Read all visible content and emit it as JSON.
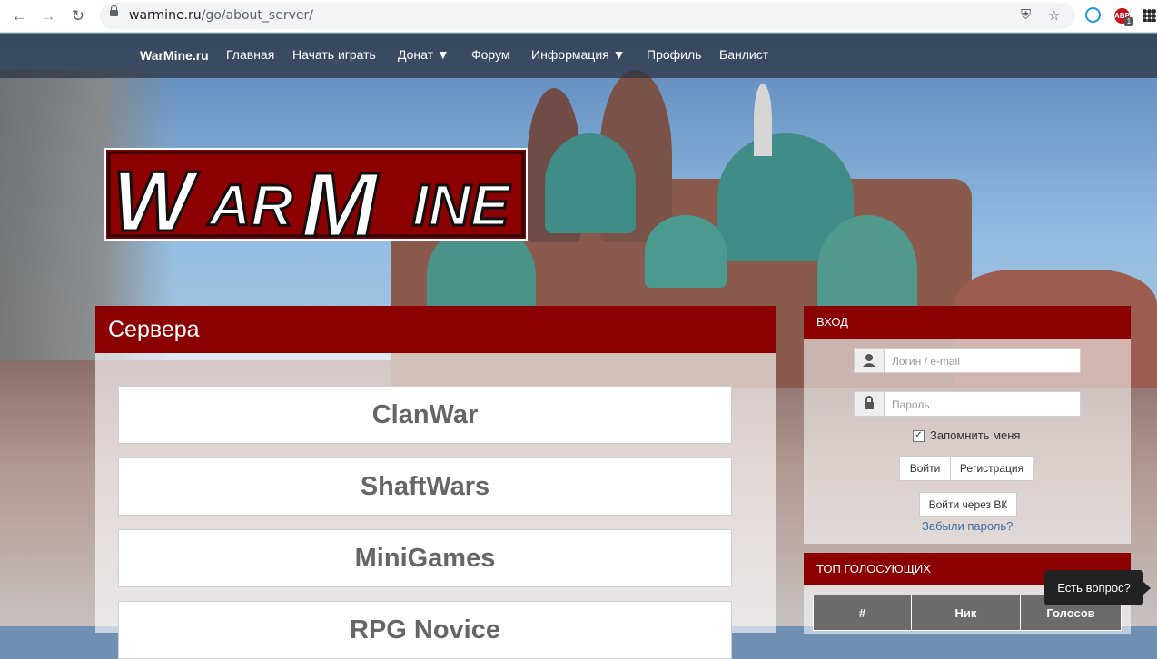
{
  "browser": {
    "url_host": "warmine.ru",
    "url_path": "/go/about_server/",
    "icons": [
      "back-icon",
      "forward-icon",
      "reload-icon",
      "lock-icon",
      "shield-icon",
      "star-icon",
      "extension-icon",
      "adblock-icon",
      "grid-icon"
    ],
    "adblock_badge": "ABP",
    "adblock_count": "1"
  },
  "nav": {
    "brand": "WarMine.ru",
    "items": [
      {
        "label": "Главная"
      },
      {
        "label": "Начать играть"
      },
      {
        "label": "Донат ▼"
      },
      {
        "label": "Форум"
      },
      {
        "label": "Информация ▼"
      },
      {
        "label": "Профиль"
      },
      {
        "label": "Банлист"
      }
    ]
  },
  "logo": {
    "text": "WarMine"
  },
  "servers": {
    "title": "Сервера",
    "list": [
      {
        "name": "ClanWar"
      },
      {
        "name": "ShaftWars"
      },
      {
        "name": "MiniGames"
      },
      {
        "name": "RPG Novice"
      }
    ]
  },
  "login": {
    "title": "ВХОД",
    "login_placeholder": "Логин / e-mail",
    "password_placeholder": "Пароль",
    "remember_label": "Запомнить меня",
    "remember_checked": true,
    "login_button": "Войти",
    "register_button": "Регистрация",
    "vk_button": "Войти через ВК",
    "forgot_link": "Забыли пароль?"
  },
  "voters": {
    "title": "ТОП ГОЛОСУЮЩИХ",
    "columns": [
      "#",
      "Ник",
      "Голосов"
    ]
  },
  "help": {
    "label": "Есть вопрос?"
  },
  "colors": {
    "accent": "#8b0000",
    "nav_bg": "#2a313e"
  }
}
